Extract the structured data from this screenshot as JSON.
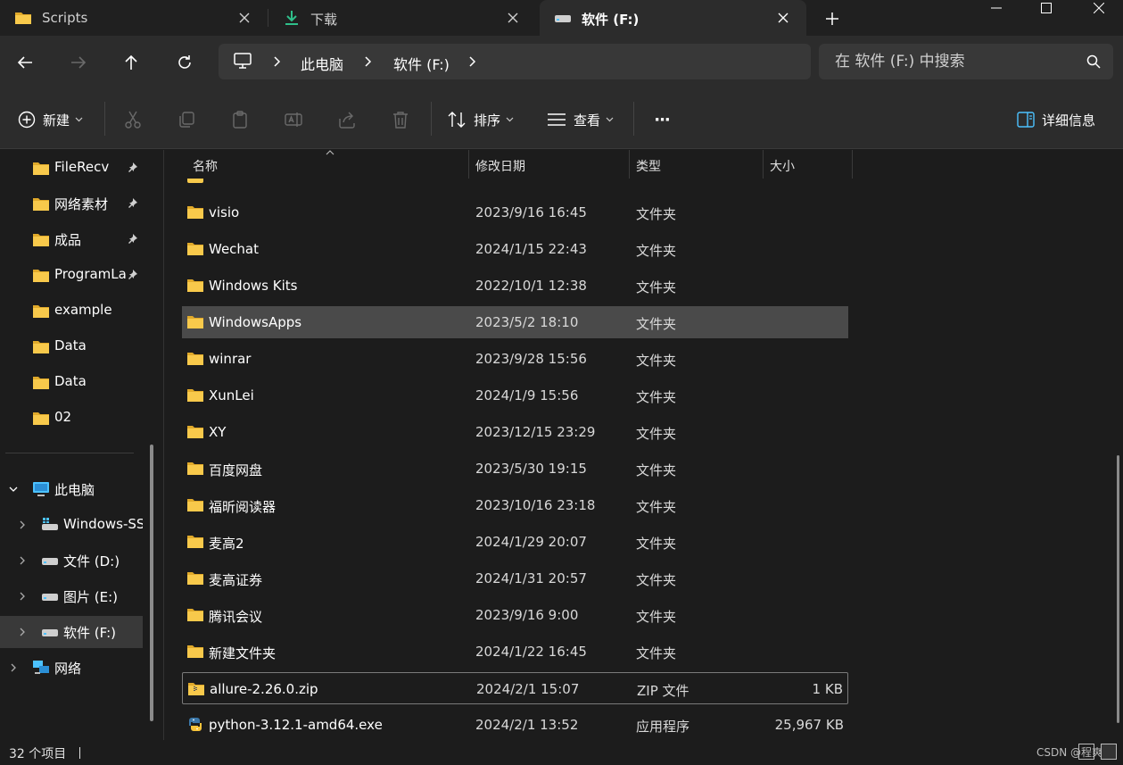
{
  "tabs": [
    {
      "label": "Scripts",
      "icon": "folder-icon"
    },
    {
      "label": "下载",
      "icon": "download-icon"
    },
    {
      "label": "软件 (F:)",
      "icon": "drive-icon"
    }
  ],
  "nav": {
    "breadcrumb": [
      "此电脑",
      "软件 (F:)"
    ],
    "search_placeholder": "在 软件 (F:) 中搜索"
  },
  "toolbar": {
    "new_label": "新建",
    "sort_label": "排序",
    "view_label": "查看",
    "more_label": "···",
    "details_label": "详细信息"
  },
  "sidebar": {
    "quick": [
      {
        "label": "FileRecv",
        "pinned": true
      },
      {
        "label": "网络素材",
        "pinned": true
      },
      {
        "label": "成品",
        "pinned": true
      },
      {
        "label": "ProgramLa",
        "pinned": true
      },
      {
        "label": "example",
        "pinned": false
      },
      {
        "label": "Data",
        "pinned": false
      },
      {
        "label": "Data",
        "pinned": false
      },
      {
        "label": "02",
        "pinned": false
      }
    ],
    "this_pc": "此电脑",
    "drives": [
      "Windows-SS",
      "文件 (D:)",
      "图片 (E:)",
      "软件 (F:)"
    ],
    "network": "网络"
  },
  "columns": {
    "name": "名称",
    "date": "修改日期",
    "type": "类型",
    "size": "大小"
  },
  "files": [
    {
      "name": "visio",
      "date": "2023/9/16 16:45",
      "type": "文件夹",
      "size": "",
      "kind": "folder"
    },
    {
      "name": "Wechat",
      "date": "2024/1/15 22:43",
      "type": "文件夹",
      "size": "",
      "kind": "folder"
    },
    {
      "name": "Windows Kits",
      "date": "2022/10/1 12:38",
      "type": "文件夹",
      "size": "",
      "kind": "folder"
    },
    {
      "name": "WindowsApps",
      "date": "2023/5/2 18:10",
      "type": "文件夹",
      "size": "",
      "kind": "folder"
    },
    {
      "name": "winrar",
      "date": "2023/9/28 15:56",
      "type": "文件夹",
      "size": "",
      "kind": "folder"
    },
    {
      "name": "XunLei",
      "date": "2024/1/9 15:56",
      "type": "文件夹",
      "size": "",
      "kind": "folder"
    },
    {
      "name": "XY",
      "date": "2023/12/15 23:29",
      "type": "文件夹",
      "size": "",
      "kind": "folder"
    },
    {
      "name": "百度网盘",
      "date": "2023/5/30 19:15",
      "type": "文件夹",
      "size": "",
      "kind": "folder"
    },
    {
      "name": "福昕阅读器",
      "date": "2023/10/16 23:18",
      "type": "文件夹",
      "size": "",
      "kind": "folder"
    },
    {
      "name": "麦高2",
      "date": "2024/1/29 20:07",
      "type": "文件夹",
      "size": "",
      "kind": "folder"
    },
    {
      "name": "麦高证券",
      "date": "2024/1/31 20:57",
      "type": "文件夹",
      "size": "",
      "kind": "folder"
    },
    {
      "name": "腾讯会议",
      "date": "2023/9/16 9:00",
      "type": "文件夹",
      "size": "",
      "kind": "folder"
    },
    {
      "name": "新建文件夹",
      "date": "2024/1/22 16:45",
      "type": "文件夹",
      "size": "",
      "kind": "folder"
    },
    {
      "name": "allure-2.26.0.zip",
      "date": "2024/2/1 15:07",
      "type": "ZIP 文件",
      "size": "1 KB",
      "kind": "zip"
    },
    {
      "name": "python-3.12.1-amd64.exe",
      "date": "2024/2/1 13:52",
      "type": "应用程序",
      "size": "25,967 KB",
      "kind": "exe"
    }
  ],
  "status": {
    "count": "32 个项目",
    "watermark": "CSDN @程爽"
  },
  "colors": {
    "folder": "#f8c94b",
    "folder_dark": "#e0a92a",
    "accent": "#4cc2ff",
    "download": "#2fbf8a"
  }
}
